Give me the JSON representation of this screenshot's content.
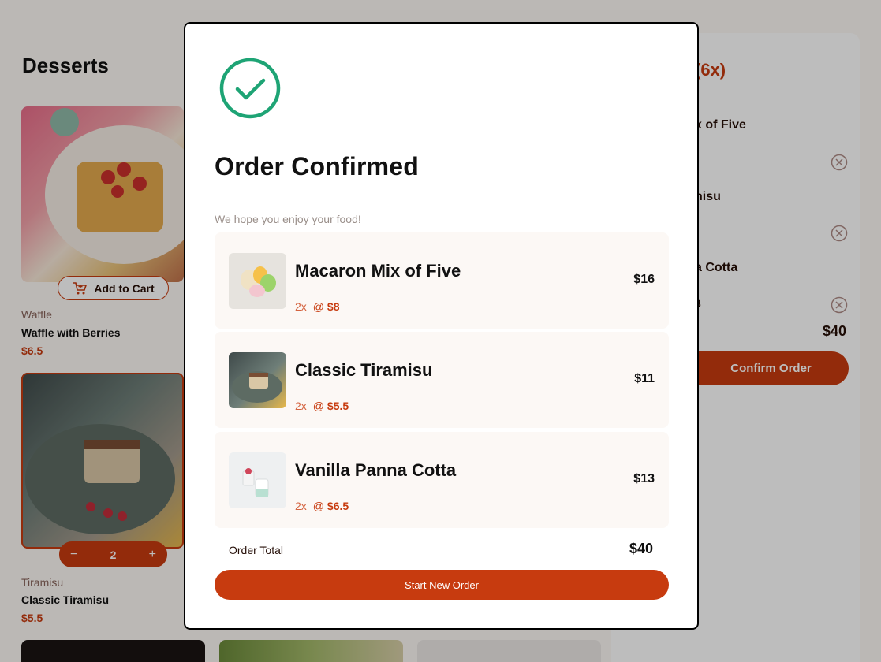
{
  "page": {
    "title": "Desserts"
  },
  "products": [
    {
      "category": "Waffle",
      "name": "Waffle with Berries",
      "price": "$6.5",
      "add_label": "Add to Cart"
    },
    {
      "category": "Tiramisu",
      "name": "Classic Tiramisu",
      "price": "$5.5",
      "quantity": "2",
      "minus": "−",
      "plus": "+"
    }
  ],
  "cart": {
    "title_partial": "(6x)",
    "items": [
      {
        "name_partial": "x of Five"
      },
      {
        "name_partial": "nisu"
      },
      {
        "name_partial": "a Cotta",
        "detail_partial": "3"
      }
    ],
    "total": "$40",
    "confirm_label_partial": "Confirm Order"
  },
  "modal": {
    "title": "Order Confirmed",
    "subtitle": "We hope you enjoy your food!",
    "items": [
      {
        "name": "Macaron Mix of Five",
        "qty": "2x",
        "at": "@",
        "unit": "$8",
        "total": "$16"
      },
      {
        "name": "Classic Tiramisu",
        "qty": "2x",
        "at": "@",
        "unit": "$5.5",
        "total": "$11"
      },
      {
        "name": "Vanilla Panna Cotta",
        "qty": "2x",
        "at": "@",
        "unit": "$6.5",
        "total": "$13"
      }
    ],
    "total_label": "Order Total",
    "total_value": "$40",
    "new_order_label": "Start New Order"
  },
  "colors": {
    "accent": "#c73b0f",
    "success": "#1ea475",
    "rose_50": "#fcf8f5"
  },
  "icons": {
    "confirmed": "check-circle-icon",
    "cart": "add-to-cart-icon",
    "remove": "remove-item-icon"
  }
}
